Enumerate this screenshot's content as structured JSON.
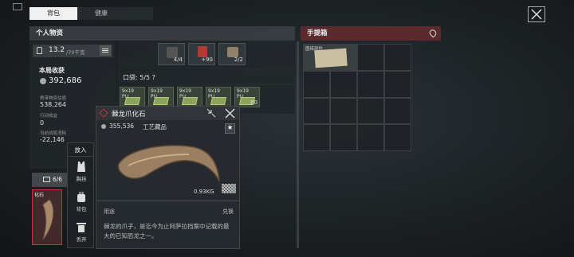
{
  "tabs": [
    {
      "label": "背包",
      "active": true
    },
    {
      "label": "健康",
      "active": false
    }
  ],
  "personal": {
    "title": "个人物资",
    "weight": "13.2",
    "weight_max": "/70千克",
    "income_label": "本局收获",
    "income_value": "392,686",
    "carry_label": "携带物资估值",
    "carry_value": "538,264",
    "action_label": "行动收益",
    "action_value": "0",
    "loss_label": "当前战局消耗",
    "loss_value": "-22,146",
    "slot_count": "6/6"
  },
  "equip_counts": {
    "a": "4/4",
    "b": "+90",
    "c": "2/2"
  },
  "pocket": {
    "label": "口袋: 5/5 ?",
    "ammo": [
      {
        "label": "9x19\nPU"
      },
      {
        "label": "9x19\nPU"
      },
      {
        "label": "9x19\nPU"
      },
      {
        "label": "9x19\nPU"
      },
      {
        "label": "9x19\nPU",
        "count": "60"
      }
    ]
  },
  "briefcase": {
    "title": "手提箱",
    "item_label": "图纸原件"
  },
  "popup": {
    "name": "棘龙爪化石",
    "price": "355,536",
    "category": "工艺藏品",
    "weight": "0.93KG",
    "usage_label": "用途",
    "exchange_label": "兑换",
    "description": "棘龙的爪子，是迄今为止阿萨拉档案中记载的最大的已知恐龙之一。"
  },
  "context_menu": {
    "title": "放入",
    "items": [
      {
        "label": "胸挂",
        "icon": "vest-icon"
      },
      {
        "label": "背包",
        "icon": "backpack-icon"
      },
      {
        "label": "丢弃",
        "icon": "trash-icon"
      }
    ]
  },
  "selected_item": {
    "label": "化石"
  },
  "colors": {
    "accent_red": "#c0353b",
    "briefcase_header": "#5a2a2e"
  }
}
